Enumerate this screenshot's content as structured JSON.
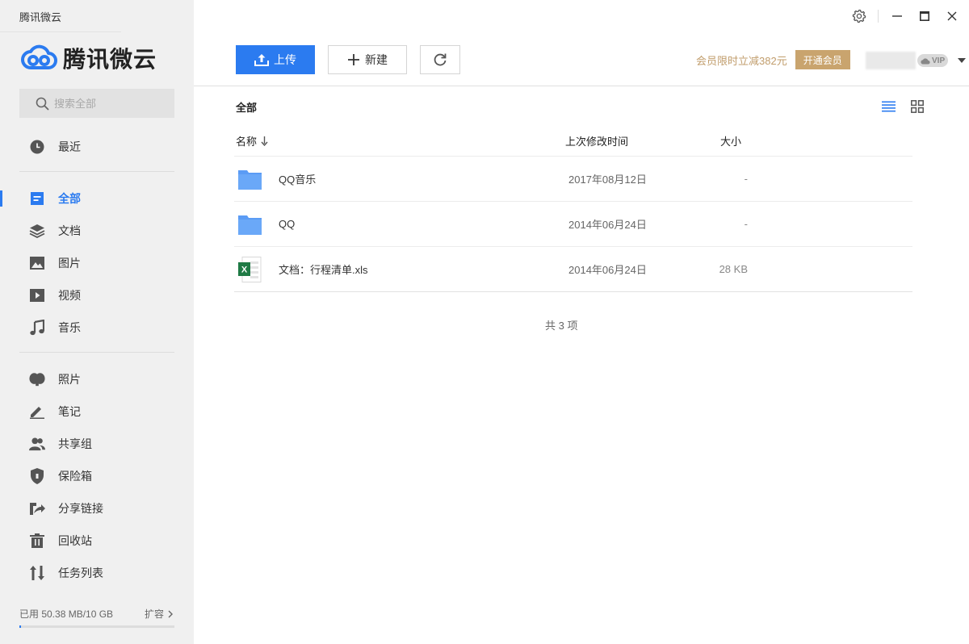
{
  "app": {
    "title": "腾讯微云",
    "logo_text": "腾讯微云"
  },
  "sidebar": {
    "search_placeholder": "搜索全部",
    "items": [
      {
        "label": "最近",
        "icon": "clock-icon"
      },
      {
        "label": "全部",
        "icon": "all-files-icon",
        "active": true
      },
      {
        "label": "文档",
        "icon": "layers-icon"
      },
      {
        "label": "图片",
        "icon": "image-icon"
      },
      {
        "label": "视频",
        "icon": "video-icon"
      },
      {
        "label": "音乐",
        "icon": "music-icon"
      },
      {
        "label": "照片",
        "icon": "photo-album-icon"
      },
      {
        "label": "笔记",
        "icon": "pen-icon"
      },
      {
        "label": "共享组",
        "icon": "group-icon"
      },
      {
        "label": "保险箱",
        "icon": "shield-icon"
      },
      {
        "label": "分享链接",
        "icon": "share-link-icon"
      },
      {
        "label": "回收站",
        "icon": "trash-icon"
      },
      {
        "label": "任务列表",
        "icon": "transfer-icon"
      }
    ],
    "storage": {
      "used_text": "已用 50.38 MB/10 GB",
      "expand_label": "扩容",
      "used_fraction": 0.005
    }
  },
  "toolbar": {
    "upload_label": "上传",
    "new_label": "新建",
    "refresh_icon": "refresh-icon"
  },
  "promo": {
    "text": "会员限时立减382元",
    "button_label": "开通会员"
  },
  "user": {
    "vip_label": "VIP"
  },
  "breadcrumb": "全部",
  "table": {
    "headers": {
      "name": "名称",
      "modified": "上次修改时间",
      "size": "大小"
    },
    "rows": [
      {
        "name": "QQ音乐",
        "type": "folder",
        "modified": "2017年08月12日",
        "size": "-"
      },
      {
        "name": "QQ",
        "type": "folder",
        "modified": "2014年06月24日",
        "size": "-"
      },
      {
        "name": "文档：行程清单.xls",
        "type": "excel",
        "modified": "2014年06月24日",
        "size": "28 KB"
      }
    ]
  },
  "count_text": "共 3 项",
  "colors": {
    "accent": "#2b7bf0",
    "promo": "#c19d6c",
    "promo_button": "#c9a46e",
    "folder": "#5b9cf5",
    "excel": "#1f7a45"
  }
}
